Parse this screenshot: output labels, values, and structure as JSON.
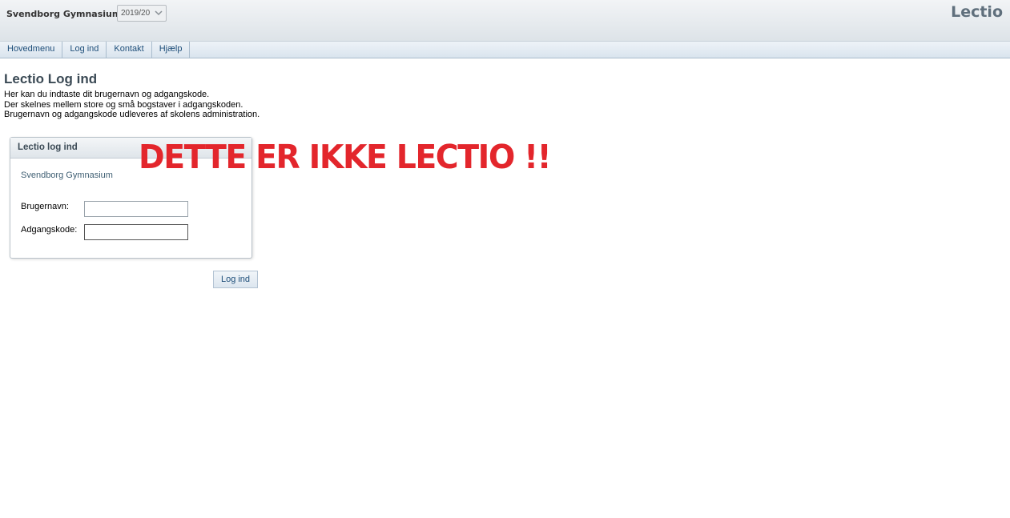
{
  "header": {
    "school_name": "Svendborg Gymnasium",
    "year_select": {
      "value": "2019/20"
    },
    "brand": "Lectio"
  },
  "menu": {
    "items": [
      {
        "label": "Hovedmenu"
      },
      {
        "label": "Log ind"
      },
      {
        "label": "Kontakt"
      },
      {
        "label": "Hjælp"
      }
    ]
  },
  "page": {
    "title": "Lectio Log ind",
    "intro_lines": [
      "Her kan du indtaste dit brugernavn og adgangskode.",
      "Der skelnes mellem store og små bogstaver i adgangskoden.",
      "Brugernavn og adgangskode udleveres af skolens administration."
    ]
  },
  "login_box": {
    "header": "Lectio log ind",
    "school": "Svendborg Gymnasium",
    "username_label": "Brugernavn:",
    "username_value": "",
    "password_label": "Adgangskode:",
    "password_value": "",
    "submit_label": "Log ind"
  },
  "warning": "DETTE ER IKKE LECTIO !!",
  "colors": {
    "warning": "#e3262c",
    "menu_text": "#1f4f7a",
    "brand": "#5f6f7c"
  }
}
